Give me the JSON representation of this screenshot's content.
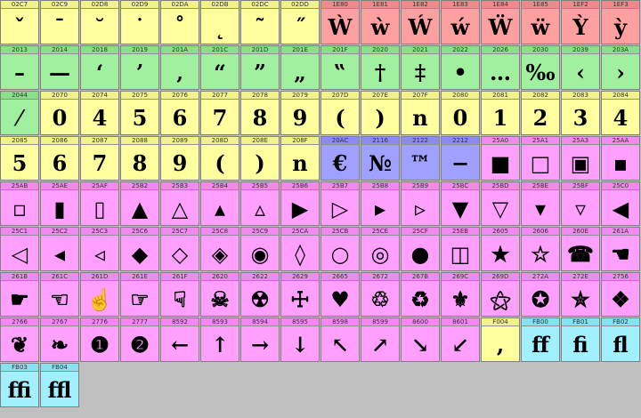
{
  "colors": {
    "yellow": "#ffffa0",
    "yellow_hdr": "#f2f28a",
    "red": "#ffa0a0",
    "red_hdr": "#f08a8a",
    "green": "#a0f0a0",
    "green_hdr": "#88e088",
    "blue": "#a0a0ff",
    "blue_hdr": "#8a8af0",
    "pink": "#ffa0ff",
    "pink_hdr": "#f08af0",
    "cyan": "#a0f0ff",
    "cyan_hdr": "#88e0f0",
    "background": "#c0c0c0"
  },
  "cells": [
    {
      "code": "02C7",
      "glyph": "ˇ",
      "c": "yellow"
    },
    {
      "code": "02C9",
      "glyph": "ˉ",
      "c": "yellow"
    },
    {
      "code": "02D8",
      "glyph": "˘",
      "c": "yellow"
    },
    {
      "code": "02D9",
      "glyph": "˙",
      "c": "yellow"
    },
    {
      "code": "02DA",
      "glyph": "˚",
      "c": "yellow"
    },
    {
      "code": "02DB",
      "glyph": "˛",
      "c": "yellow"
    },
    {
      "code": "02DC",
      "glyph": "˜",
      "c": "yellow"
    },
    {
      "code": "02DD",
      "glyph": "˝",
      "c": "yellow"
    },
    {
      "code": "1E80",
      "glyph": "Ẁ",
      "c": "red"
    },
    {
      "code": "1E81",
      "glyph": "ẁ",
      "c": "red"
    },
    {
      "code": "1E82",
      "glyph": "Ẃ",
      "c": "red"
    },
    {
      "code": "1E83",
      "glyph": "ẃ",
      "c": "red"
    },
    {
      "code": "1E84",
      "glyph": "Ẅ",
      "c": "red"
    },
    {
      "code": "1E85",
      "glyph": "ẅ",
      "c": "red"
    },
    {
      "code": "1EF2",
      "glyph": "Ỳ",
      "c": "red"
    },
    {
      "code": "1EF3",
      "glyph": "ỳ",
      "c": "red"
    },
    {
      "code": "2013",
      "glyph": "–",
      "c": "green"
    },
    {
      "code": "2014",
      "glyph": "—",
      "c": "green"
    },
    {
      "code": "2018",
      "glyph": "‘",
      "c": "green"
    },
    {
      "code": "2019",
      "glyph": "’",
      "c": "green"
    },
    {
      "code": "201A",
      "glyph": "‚",
      "c": "green"
    },
    {
      "code": "201C",
      "glyph": "“",
      "c": "green"
    },
    {
      "code": "201D",
      "glyph": "”",
      "c": "green"
    },
    {
      "code": "201E",
      "glyph": "„",
      "c": "green"
    },
    {
      "code": "201F",
      "glyph": "‟",
      "c": "green"
    },
    {
      "code": "2020",
      "glyph": "†",
      "c": "green"
    },
    {
      "code": "2021",
      "glyph": "‡",
      "c": "green"
    },
    {
      "code": "2022",
      "glyph": "•",
      "c": "green"
    },
    {
      "code": "2026",
      "glyph": "…",
      "c": "green"
    },
    {
      "code": "2030",
      "glyph": "‰",
      "c": "green"
    },
    {
      "code": "2039",
      "glyph": "‹",
      "c": "green"
    },
    {
      "code": "203A",
      "glyph": "›",
      "c": "green"
    },
    {
      "code": "2044",
      "glyph": "⁄",
      "c": "green"
    },
    {
      "code": "2070",
      "glyph": "0",
      "c": "yellow"
    },
    {
      "code": "2074",
      "glyph": "4",
      "c": "yellow"
    },
    {
      "code": "2075",
      "glyph": "5",
      "c": "yellow"
    },
    {
      "code": "2076",
      "glyph": "6",
      "c": "yellow"
    },
    {
      "code": "2077",
      "glyph": "7",
      "c": "yellow"
    },
    {
      "code": "2078",
      "glyph": "8",
      "c": "yellow"
    },
    {
      "code": "2079",
      "glyph": "9",
      "c": "yellow"
    },
    {
      "code": "207D",
      "glyph": "(",
      "c": "yellow"
    },
    {
      "code": "207E",
      "glyph": ")",
      "c": "yellow"
    },
    {
      "code": "207F",
      "glyph": "n",
      "c": "yellow"
    },
    {
      "code": "2080",
      "glyph": "0",
      "c": "yellow"
    },
    {
      "code": "2081",
      "glyph": "1",
      "c": "yellow"
    },
    {
      "code": "2082",
      "glyph": "2",
      "c": "yellow"
    },
    {
      "code": "2083",
      "glyph": "3",
      "c": "yellow"
    },
    {
      "code": "2084",
      "glyph": "4",
      "c": "yellow"
    },
    {
      "code": "2085",
      "glyph": "5",
      "c": "yellow"
    },
    {
      "code": "2086",
      "glyph": "6",
      "c": "yellow"
    },
    {
      "code": "2087",
      "glyph": "7",
      "c": "yellow"
    },
    {
      "code": "2088",
      "glyph": "8",
      "c": "yellow"
    },
    {
      "code": "2089",
      "glyph": "9",
      "c": "yellow"
    },
    {
      "code": "208D",
      "glyph": "(",
      "c": "yellow"
    },
    {
      "code": "208E",
      "glyph": ")",
      "c": "yellow"
    },
    {
      "code": "208F",
      "glyph": "n",
      "c": "yellow"
    },
    {
      "code": "20AC",
      "glyph": "€",
      "c": "blue"
    },
    {
      "code": "2116",
      "glyph": "№",
      "c": "blue"
    },
    {
      "code": "2122",
      "glyph": "™",
      "c": "blue"
    },
    {
      "code": "2212",
      "glyph": "−",
      "c": "blue"
    },
    {
      "code": "25A0",
      "glyph": "■",
      "c": "pink"
    },
    {
      "code": "25A1",
      "glyph": "□",
      "c": "pink"
    },
    {
      "code": "25A3",
      "glyph": "▣",
      "c": "pink"
    },
    {
      "code": "25AA",
      "glyph": "▪",
      "c": "pink"
    },
    {
      "code": "25AB",
      "glyph": "▫",
      "c": "pink"
    },
    {
      "code": "25AE",
      "glyph": "▮",
      "c": "pink"
    },
    {
      "code": "25AF",
      "glyph": "▯",
      "c": "pink"
    },
    {
      "code": "25B2",
      "glyph": "▲",
      "c": "pink"
    },
    {
      "code": "25B3",
      "glyph": "△",
      "c": "pink"
    },
    {
      "code": "25B4",
      "glyph": "▴",
      "c": "pink"
    },
    {
      "code": "25B5",
      "glyph": "▵",
      "c": "pink"
    },
    {
      "code": "25B6",
      "glyph": "▶",
      "c": "pink"
    },
    {
      "code": "25B7",
      "glyph": "▷",
      "c": "pink"
    },
    {
      "code": "25B8",
      "glyph": "▸",
      "c": "pink"
    },
    {
      "code": "25B9",
      "glyph": "▹",
      "c": "pink"
    },
    {
      "code": "25BC",
      "glyph": "▼",
      "c": "pink"
    },
    {
      "code": "25BD",
      "glyph": "▽",
      "c": "pink"
    },
    {
      "code": "25BE",
      "glyph": "▾",
      "c": "pink"
    },
    {
      "code": "25BF",
      "glyph": "▿",
      "c": "pink"
    },
    {
      "code": "25C0",
      "glyph": "◀",
      "c": "pink"
    },
    {
      "code": "25C1",
      "glyph": "◁",
      "c": "pink"
    },
    {
      "code": "25C2",
      "glyph": "◂",
      "c": "pink"
    },
    {
      "code": "25C3",
      "glyph": "◃",
      "c": "pink"
    },
    {
      "code": "25C6",
      "glyph": "◆",
      "c": "pink"
    },
    {
      "code": "25C7",
      "glyph": "◇",
      "c": "pink"
    },
    {
      "code": "25C8",
      "glyph": "◈",
      "c": "pink"
    },
    {
      "code": "25C9",
      "glyph": "◉",
      "c": "pink"
    },
    {
      "code": "25CA",
      "glyph": "◊",
      "c": "pink"
    },
    {
      "code": "25CB",
      "glyph": "○",
      "c": "pink"
    },
    {
      "code": "25CE",
      "glyph": "◎",
      "c": "pink"
    },
    {
      "code": "25CF",
      "glyph": "●",
      "c": "pink"
    },
    {
      "code": "25EB",
      "glyph": "◫",
      "c": "pink"
    },
    {
      "code": "2605",
      "glyph": "★",
      "c": "pink"
    },
    {
      "code": "2606",
      "glyph": "☆",
      "c": "pink"
    },
    {
      "code": "260E",
      "glyph": "☎",
      "c": "pink"
    },
    {
      "code": "261A",
      "glyph": "☚",
      "c": "pink"
    },
    {
      "code": "261B",
      "glyph": "☛",
      "c": "pink"
    },
    {
      "code": "261C",
      "glyph": "☜",
      "c": "pink"
    },
    {
      "code": "261D",
      "glyph": "☝",
      "c": "pink"
    },
    {
      "code": "261E",
      "glyph": "☞",
      "c": "pink"
    },
    {
      "code": "261F",
      "glyph": "☟",
      "c": "pink"
    },
    {
      "code": "2620",
      "glyph": "☠",
      "c": "pink"
    },
    {
      "code": "2622",
      "glyph": "☢",
      "c": "pink"
    },
    {
      "code": "2629",
      "glyph": "☩",
      "c": "pink"
    },
    {
      "code": "2665",
      "glyph": "♥",
      "c": "pink"
    },
    {
      "code": "2672",
      "glyph": "♲",
      "c": "pink"
    },
    {
      "code": "267B",
      "glyph": "♻",
      "c": "pink"
    },
    {
      "code": "269C",
      "glyph": "⚜",
      "c": "pink"
    },
    {
      "code": "269D",
      "glyph": "⚝",
      "c": "pink"
    },
    {
      "code": "272A",
      "glyph": "✪",
      "c": "pink"
    },
    {
      "code": "272E",
      "glyph": "✮",
      "c": "pink"
    },
    {
      "code": "2756",
      "glyph": "❖",
      "c": "pink"
    },
    {
      "code": "2766",
      "glyph": "❦",
      "c": "pink"
    },
    {
      "code": "2767",
      "glyph": "❧",
      "c": "pink"
    },
    {
      "code": "2776",
      "glyph": "❶",
      "c": "pink"
    },
    {
      "code": "2777",
      "glyph": "❷",
      "c": "pink"
    },
    {
      "code": "8592",
      "glyph": "←",
      "c": "pink"
    },
    {
      "code": "8593",
      "glyph": "↑",
      "c": "pink"
    },
    {
      "code": "8594",
      "glyph": "→",
      "c": "pink"
    },
    {
      "code": "8595",
      "glyph": "↓",
      "c": "pink"
    },
    {
      "code": "8598",
      "glyph": "↖",
      "c": "pink"
    },
    {
      "code": "8599",
      "glyph": "↗",
      "c": "pink"
    },
    {
      "code": "8600",
      "glyph": "↘",
      "c": "pink"
    },
    {
      "code": "8601",
      "glyph": "↙",
      "c": "pink"
    },
    {
      "code": "F004",
      "glyph": ",",
      "c": "yellow"
    },
    {
      "code": "FB00",
      "glyph": "ﬀ",
      "c": "cyan"
    },
    {
      "code": "FB01",
      "glyph": "ﬁ",
      "c": "cyan"
    },
    {
      "code": "FB02",
      "glyph": "ﬂ",
      "c": "cyan"
    },
    {
      "code": "FB03",
      "glyph": "ﬃ",
      "c": "cyan"
    },
    {
      "code": "FB04",
      "glyph": "ﬄ",
      "c": "cyan"
    }
  ]
}
